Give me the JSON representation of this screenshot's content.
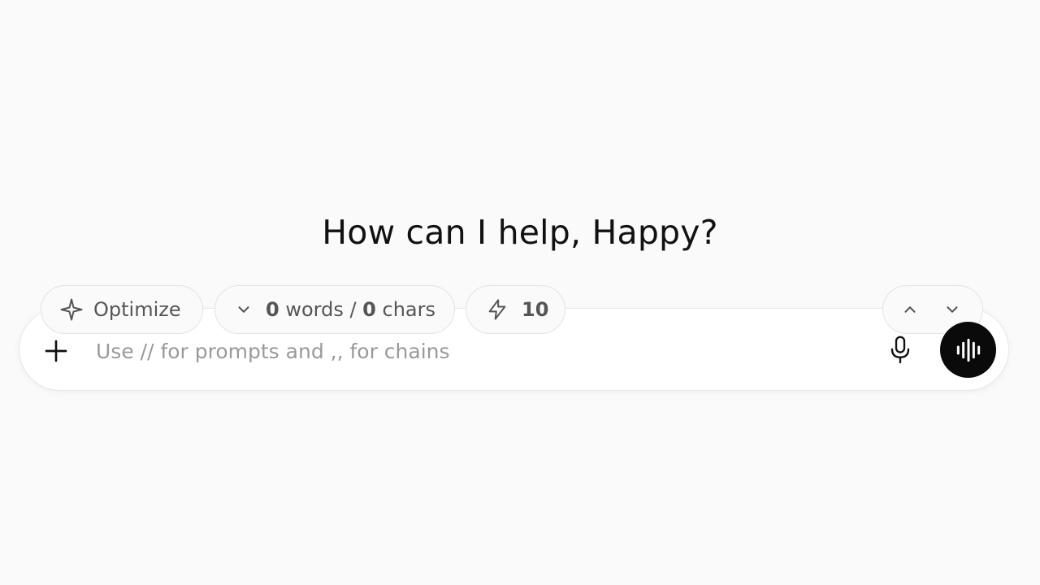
{
  "greeting": "How can I help, Happy?",
  "toolbar": {
    "optimize_label": "Optimize",
    "word_count": "0",
    "words_label": " words / ",
    "char_count": "0",
    "chars_label": " chars",
    "credits": "10"
  },
  "composer": {
    "placeholder": "Use // for prompts and ,, for chains",
    "value": ""
  },
  "icons": {
    "optimize": "sparkle-icon",
    "count_toggle": "chevron-down-icon",
    "credits": "lightning-icon",
    "nav_up": "chevron-up-icon",
    "nav_down": "chevron-down-icon",
    "add": "plus-icon",
    "mic": "microphone-icon",
    "voice": "voice-waveform-icon"
  },
  "colors": {
    "background": "#fafafa",
    "composer": "#ffffff",
    "voice_button": "#0a0a0a",
    "placeholder": "#9a9a9a"
  }
}
